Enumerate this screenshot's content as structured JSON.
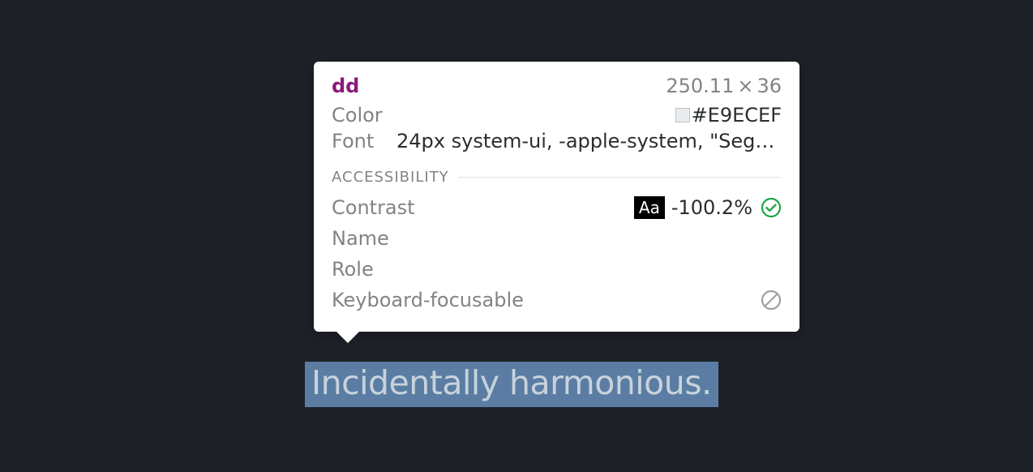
{
  "inspected": {
    "tag": "dd",
    "width": "250.11",
    "height": "36",
    "text": "Incidentally harmonious."
  },
  "styles": {
    "color_label": "Color",
    "color_value": "#E9ECEF",
    "color_swatch": "#E9ECEF",
    "font_label": "Font",
    "font_value": "24px system-ui, -apple-system, \"Segoe…"
  },
  "accessibility": {
    "section_title": "Accessibility",
    "contrast_label": "Contrast",
    "contrast_badge": "Aa",
    "contrast_value": "-100.2%",
    "name_label": "Name",
    "role_label": "Role",
    "focusable_label": "Keyboard-focusable"
  }
}
